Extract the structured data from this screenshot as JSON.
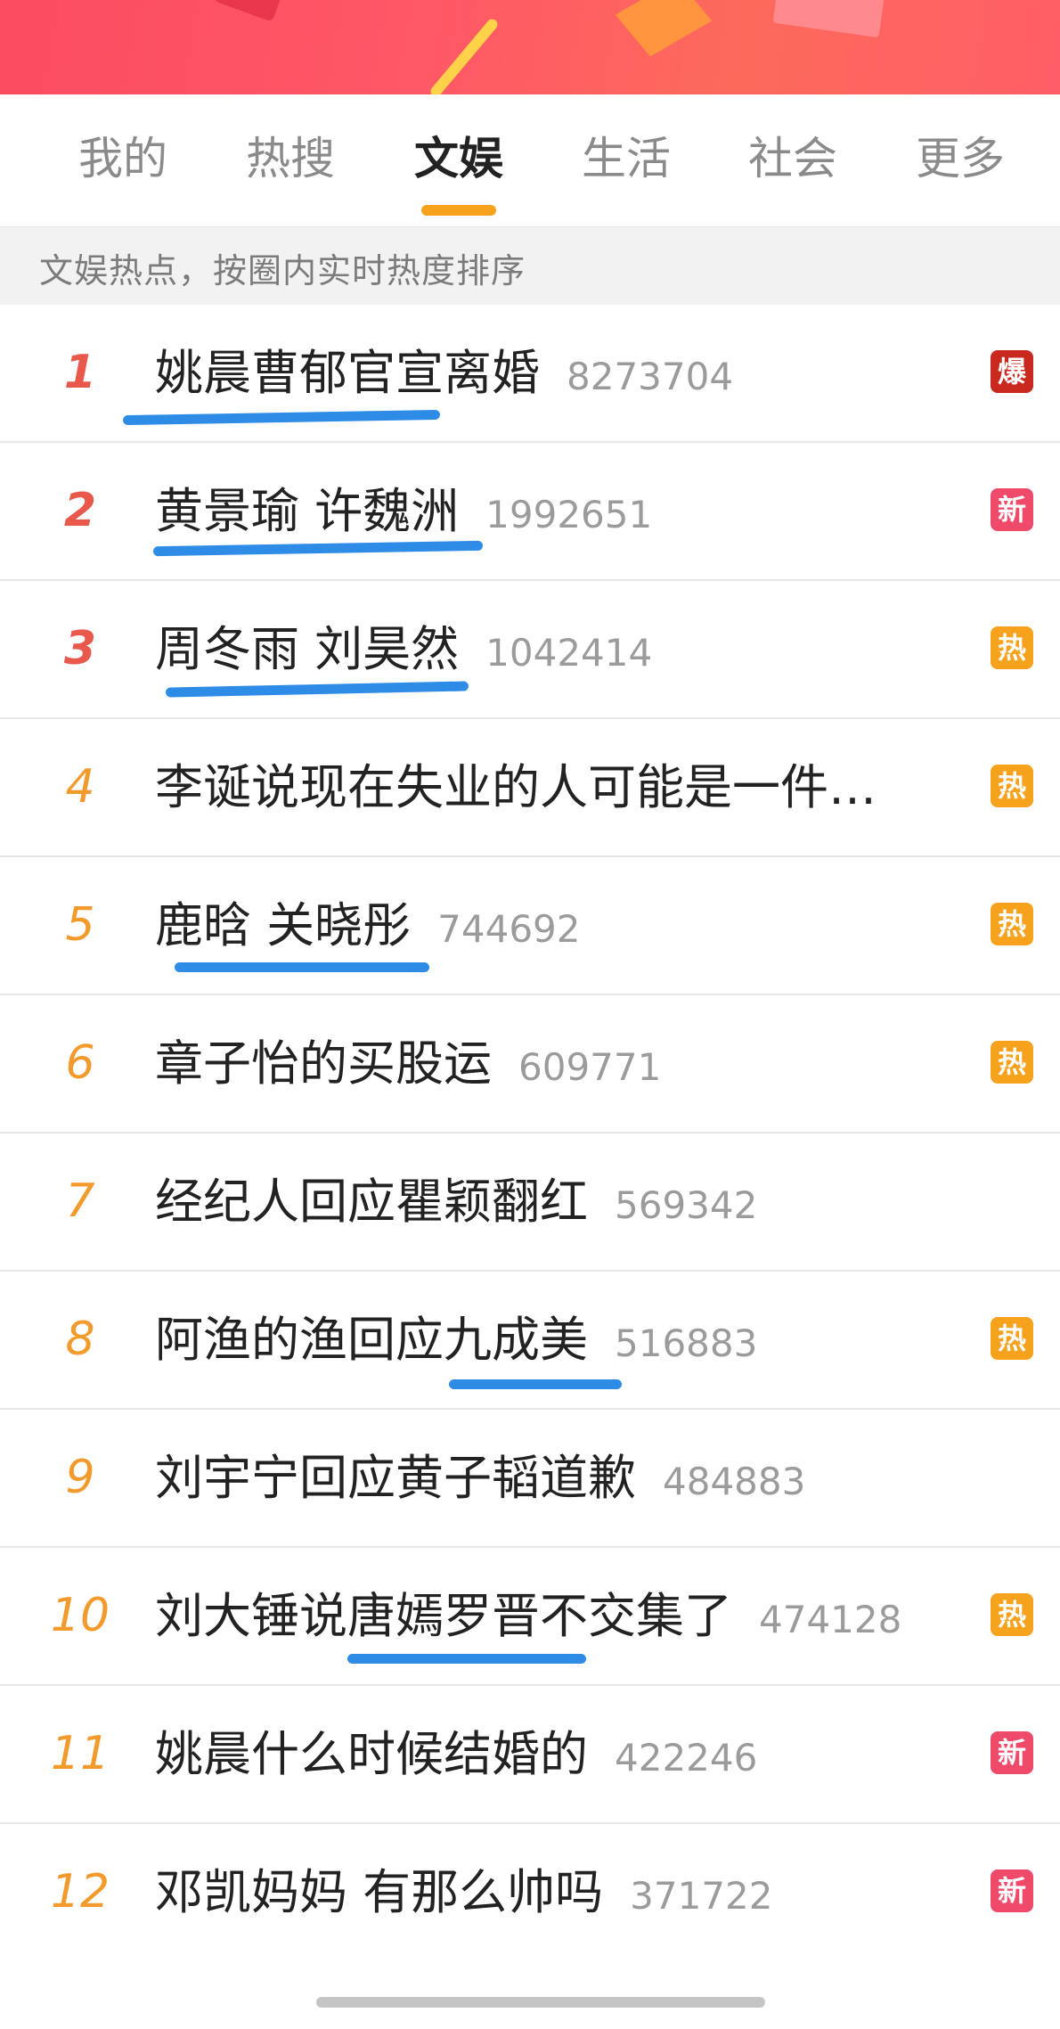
{
  "colors": {
    "banner": "#fb4b61",
    "active_tab_indicator": "#f6a21c",
    "rank_top": "#e8584b",
    "rank_other": "#f39a2c",
    "badge_bao": "#c9281f",
    "badge_xin": "#f04a6b",
    "badge_re": "#f6a21c",
    "hand_underline": "#2e8ce6"
  },
  "tabs": [
    {
      "label": "我的",
      "active": false
    },
    {
      "label": "热搜",
      "active": false
    },
    {
      "label": "文娱",
      "active": true
    },
    {
      "label": "生活",
      "active": false
    },
    {
      "label": "社会",
      "active": false
    },
    {
      "label": "更多",
      "active": false
    }
  ],
  "subheader": "文娱热点，按圈内实时热度排序",
  "items": [
    {
      "rank": "1",
      "title": "姚晨曹郁官宣离婚",
      "count": "8273704",
      "badge": "爆",
      "badge_type": "bao"
    },
    {
      "rank": "2",
      "title": "黄景瑜 许魏洲",
      "count": "1992651",
      "badge": "新",
      "badge_type": "xin"
    },
    {
      "rank": "3",
      "title": "周冬雨 刘昊然",
      "count": "1042414",
      "badge": "热",
      "badge_type": "re"
    },
    {
      "rank": "4",
      "title": "李诞说现在失业的人可能是一件…",
      "count": "",
      "badge": "热",
      "badge_type": "re"
    },
    {
      "rank": "5",
      "title": "鹿晗 关晓彤",
      "count": "744692",
      "badge": "热",
      "badge_type": "re"
    },
    {
      "rank": "6",
      "title": "章子怡的买股运",
      "count": "609771",
      "badge": "热",
      "badge_type": "re"
    },
    {
      "rank": "7",
      "title": "经纪人回应瞿颖翻红",
      "count": "569342",
      "badge": "",
      "badge_type": "none"
    },
    {
      "rank": "8",
      "title": "阿渔的渔回应九成美",
      "count": "516883",
      "badge": "热",
      "badge_type": "re"
    },
    {
      "rank": "9",
      "title": "刘宇宁回应黄子韬道歉",
      "count": "484883",
      "badge": "",
      "badge_type": "none"
    },
    {
      "rank": "10",
      "title": "刘大锤说唐嫣罗晋不交集了",
      "count": "474128",
      "badge": "热",
      "badge_type": "re"
    },
    {
      "rank": "11",
      "title": "姚晨什么时候结婚的",
      "count": "422246",
      "badge": "新",
      "badge_type": "xin"
    },
    {
      "rank": "12",
      "title": "邓凯妈妈 有那么帅吗",
      "count": "371722",
      "badge": "新",
      "badge_type": "xin"
    }
  ]
}
